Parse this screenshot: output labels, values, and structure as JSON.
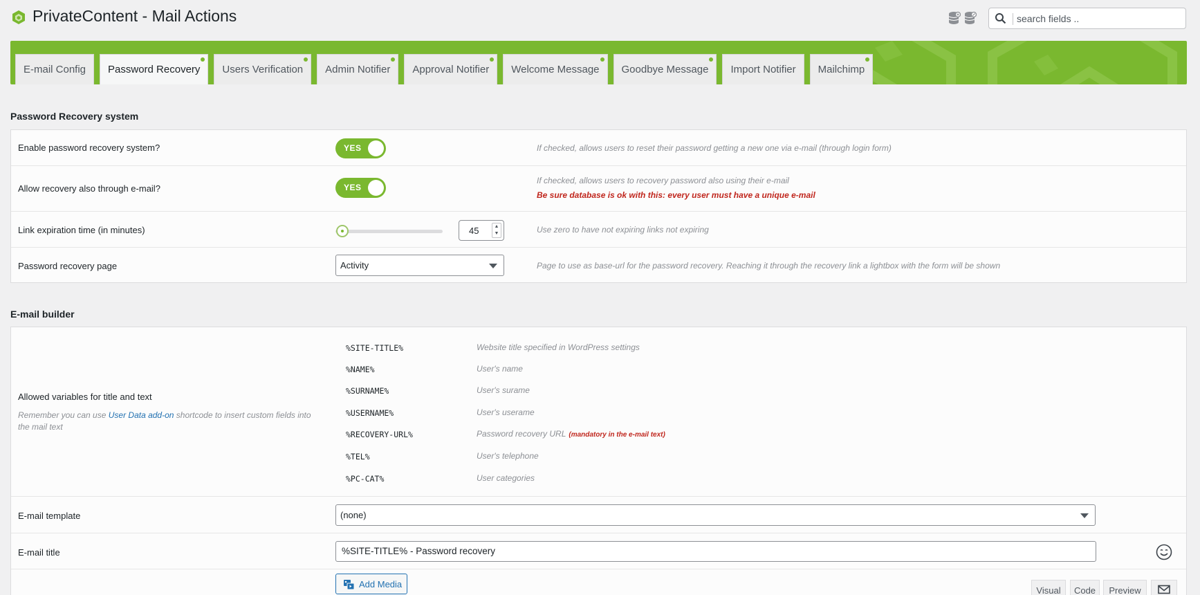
{
  "header": {
    "title": "PrivateContent - Mail Actions",
    "icons": [
      "database-icon",
      "database-settings-icon"
    ],
    "search": {
      "placeholder": "search fields ..",
      "value": ""
    }
  },
  "tabs": [
    {
      "label": "E-mail Config",
      "active": false,
      "dot": false
    },
    {
      "label": "Password Recovery",
      "active": true,
      "dot": true
    },
    {
      "label": "Users Verification",
      "active": false,
      "dot": true
    },
    {
      "label": "Admin Notifier",
      "active": false,
      "dot": true
    },
    {
      "label": "Approval Notifier",
      "active": false,
      "dot": true
    },
    {
      "label": "Welcome Message",
      "active": false,
      "dot": true
    },
    {
      "label": "Goodbye Message",
      "active": false,
      "dot": true
    },
    {
      "label": "Import Notifier",
      "active": false,
      "dot": false
    },
    {
      "label": "Mailchimp",
      "active": false,
      "dot": true
    }
  ],
  "recovery": {
    "section_title": "Password Recovery system",
    "enable": {
      "label": "Enable password recovery system?",
      "toggle": "YES",
      "note": "If checked, allows users to reset their password getting a new one via e-mail (through login form)"
    },
    "allow_email": {
      "label": "Allow recovery also through e-mail?",
      "toggle": "YES",
      "note": "If checked, allows users to recovery password also using their e-mail",
      "warning": "Be sure database is ok with this: every user must have a unique e-mail"
    },
    "expiration": {
      "label": "Link expiration time (in minutes)",
      "value": "45",
      "note": "Use zero to have not expiring links not expiring"
    },
    "page": {
      "label": "Password recovery page",
      "value": "Activity",
      "note": "Page to use as base-url for the password recovery. Reaching it through the recovery link a lightbox with the form will be shown"
    }
  },
  "builder": {
    "section_title": "E-mail builder",
    "variables_label": "Allowed variables for title and text",
    "variables_note_pre": "Remember you can use ",
    "variables_note_link": "User Data add-on",
    "variables_note_post": " shortcode to insert custom fields into the mail text",
    "variables": [
      {
        "name": "%SITE-TITLE%",
        "desc": "Website title specified in WordPress settings",
        "mandatory": ""
      },
      {
        "name": "%NAME%",
        "desc": "User's name",
        "mandatory": ""
      },
      {
        "name": "%SURNAME%",
        "desc": "User's surame",
        "mandatory": ""
      },
      {
        "name": "%USERNAME%",
        "desc": "User's userame",
        "mandatory": ""
      },
      {
        "name": "%RECOVERY-URL%",
        "desc": "Password recovery URL",
        "mandatory": "(mandatory in the e-mail text)"
      },
      {
        "name": "%TEL%",
        "desc": "User's telephone",
        "mandatory": ""
      },
      {
        "name": "%PC-CAT%",
        "desc": "User categories",
        "mandatory": ""
      }
    ],
    "template": {
      "label": "E-mail template",
      "value": "(none)"
    },
    "mail_title": {
      "label": "E-mail title",
      "value": "%SITE-TITLE% - Password recovery"
    },
    "editor": {
      "add_media": "Add Media",
      "visual": "Visual",
      "code": "Code",
      "preview": "Preview"
    }
  },
  "colors": {
    "accent": "#7ab82f",
    "warning": "#c0261d",
    "link": "#2271b1"
  }
}
